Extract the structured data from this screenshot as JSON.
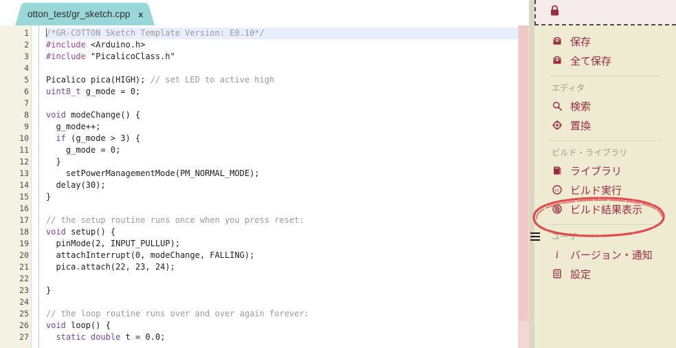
{
  "editor": {
    "tab": {
      "label": "otton_test/gr_sketch.cpp",
      "close": "x"
    },
    "first_line": 1,
    "lines": [
      {
        "n": 1,
        "fold": true,
        "selected": true,
        "cursor": true,
        "tokens": [
          {
            "t": "cmt",
            "s": "/*GR-COTTON Sketch Template Version: E0.10*/"
          }
        ]
      },
      {
        "n": 2,
        "fold": false,
        "selected": false,
        "cursor": false,
        "tokens": [
          {
            "t": "pre",
            "s": "#include"
          },
          {
            "t": "txt",
            "s": " "
          },
          {
            "t": "str",
            "s": "<Arduino.h>"
          }
        ]
      },
      {
        "n": 3,
        "fold": false,
        "selected": false,
        "cursor": false,
        "tokens": [
          {
            "t": "pre",
            "s": "#include"
          },
          {
            "t": "txt",
            "s": " "
          },
          {
            "t": "str",
            "s": "\"PicalicoClass.h\""
          }
        ]
      },
      {
        "n": 4,
        "fold": false,
        "selected": false,
        "cursor": false,
        "tokens": []
      },
      {
        "n": 5,
        "fold": false,
        "selected": false,
        "cursor": false,
        "tokens": [
          {
            "t": "txt",
            "s": "Picalico pica(HIGH); "
          },
          {
            "t": "cmt",
            "s": "// set LED to active high"
          }
        ]
      },
      {
        "n": 6,
        "fold": false,
        "selected": false,
        "cursor": false,
        "tokens": [
          {
            "t": "typ",
            "s": "uint8_t"
          },
          {
            "t": "txt",
            "s": " g_mode = 0;"
          }
        ]
      },
      {
        "n": 7,
        "fold": false,
        "selected": false,
        "cursor": false,
        "tokens": []
      },
      {
        "n": 8,
        "fold": true,
        "selected": false,
        "cursor": false,
        "tokens": [
          {
            "t": "kw",
            "s": "void"
          },
          {
            "t": "txt",
            "s": " modeChange() {"
          }
        ]
      },
      {
        "n": 9,
        "fold": false,
        "selected": false,
        "cursor": false,
        "tokens": [
          {
            "t": "txt",
            "s": "  g_mode++;"
          }
        ]
      },
      {
        "n": 10,
        "fold": true,
        "selected": false,
        "cursor": false,
        "tokens": [
          {
            "t": "txt",
            "s": "  "
          },
          {
            "t": "kw",
            "s": "if"
          },
          {
            "t": "txt",
            "s": " (g_mode > 3) {"
          }
        ]
      },
      {
        "n": 11,
        "fold": false,
        "selected": false,
        "cursor": false,
        "tokens": [
          {
            "t": "txt",
            "s": "    g_mode = 0;"
          }
        ]
      },
      {
        "n": 12,
        "fold": false,
        "selected": false,
        "cursor": false,
        "tokens": [
          {
            "t": "txt",
            "s": "  }"
          }
        ]
      },
      {
        "n": 13,
        "fold": false,
        "selected": false,
        "cursor": false,
        "tokens": [
          {
            "t": "txt",
            "s": "    setPowerManagementMode(PM_NORMAL_MODE);"
          }
        ]
      },
      {
        "n": 14,
        "fold": false,
        "selected": false,
        "cursor": false,
        "tokens": [
          {
            "t": "txt",
            "s": "  delay(30);"
          }
        ]
      },
      {
        "n": 15,
        "fold": false,
        "selected": false,
        "cursor": false,
        "tokens": [
          {
            "t": "txt",
            "s": "}"
          }
        ]
      },
      {
        "n": 16,
        "fold": false,
        "selected": false,
        "cursor": false,
        "tokens": []
      },
      {
        "n": 17,
        "fold": false,
        "selected": false,
        "cursor": false,
        "tokens": [
          {
            "t": "cmt",
            "s": "// the setup routine runs once when you press reset:"
          }
        ]
      },
      {
        "n": 18,
        "fold": true,
        "selected": false,
        "cursor": false,
        "tokens": [
          {
            "t": "kw",
            "s": "void"
          },
          {
            "t": "txt",
            "s": " setup() {"
          }
        ]
      },
      {
        "n": 19,
        "fold": false,
        "selected": false,
        "cursor": false,
        "tokens": [
          {
            "t": "txt",
            "s": "  pinMode(2, INPUT_PULLUP);"
          }
        ]
      },
      {
        "n": 20,
        "fold": false,
        "selected": false,
        "cursor": false,
        "tokens": [
          {
            "t": "txt",
            "s": "  attachInterrupt(0, modeChange, FALLING);"
          }
        ]
      },
      {
        "n": 21,
        "fold": false,
        "selected": false,
        "cursor": false,
        "tokens": [
          {
            "t": "txt",
            "s": "  pica.attach(22, 23, 24);"
          }
        ]
      },
      {
        "n": 22,
        "fold": false,
        "selected": false,
        "cursor": false,
        "tokens": []
      },
      {
        "n": 23,
        "fold": false,
        "selected": false,
        "cursor": false,
        "tokens": [
          {
            "t": "txt",
            "s": "}"
          }
        ]
      },
      {
        "n": 24,
        "fold": false,
        "selected": false,
        "cursor": false,
        "tokens": []
      },
      {
        "n": 25,
        "fold": false,
        "selected": false,
        "cursor": false,
        "tokens": [
          {
            "t": "cmt",
            "s": "// the loop routine runs over and over again forever:"
          }
        ]
      },
      {
        "n": 26,
        "fold": true,
        "selected": false,
        "cursor": false,
        "tokens": [
          {
            "t": "kw",
            "s": "void"
          },
          {
            "t": "txt",
            "s": " loop() {"
          }
        ]
      },
      {
        "n": 27,
        "fold": false,
        "selected": false,
        "cursor": false,
        "tokens": [
          {
            "t": "txt",
            "s": "  "
          },
          {
            "t": "kw",
            "s": "static"
          },
          {
            "t": "txt",
            "s": " "
          },
          {
            "t": "typ",
            "s": "double"
          },
          {
            "t": "txt",
            "s": " t = 0.0;"
          }
        ]
      }
    ]
  },
  "sidebar": {
    "lock_icon": "lock-icon",
    "sections": [
      {
        "id": "file",
        "header": null,
        "items": [
          {
            "icon": "save-icon",
            "label": "保存"
          },
          {
            "icon": "save-all-icon",
            "label": "全て保存"
          }
        ]
      },
      {
        "id": "editor",
        "header": "エディタ",
        "items": [
          {
            "icon": "search-icon",
            "label": "検索"
          },
          {
            "icon": "replace-icon",
            "label": "置換"
          }
        ]
      },
      {
        "id": "build",
        "header": "ビルド・ライブラリ",
        "items": [
          {
            "icon": "book-icon",
            "label": "ライブラリ"
          },
          {
            "icon": "compile-cc-icon",
            "label": "ビルド実行"
          },
          {
            "icon": "build-result-icon",
            "label": "ビルド結果表示"
          }
        ]
      },
      {
        "id": "user",
        "header": "ユーザ",
        "items": [
          {
            "icon": "info-icon",
            "label": "バージョン・通知"
          },
          {
            "icon": "settings-icon",
            "label": "設定"
          }
        ]
      }
    ],
    "handle_icon": "hamburger-menu-icon"
  },
  "annotation": {
    "shape": "hand-drawn-red-ellipse",
    "targets": "ビルド実行",
    "color": "#e24a4a"
  },
  "colors": {
    "tab_active": "#9ad7d8",
    "sidebar_bg": "#efead2",
    "sidebar_text": "#9c2a3f",
    "gutter_bg": "#f3f2e3",
    "selection": "#e8eefb",
    "scrollbar": "#f3d7d7",
    "annotation_red": "#e24a4a"
  }
}
